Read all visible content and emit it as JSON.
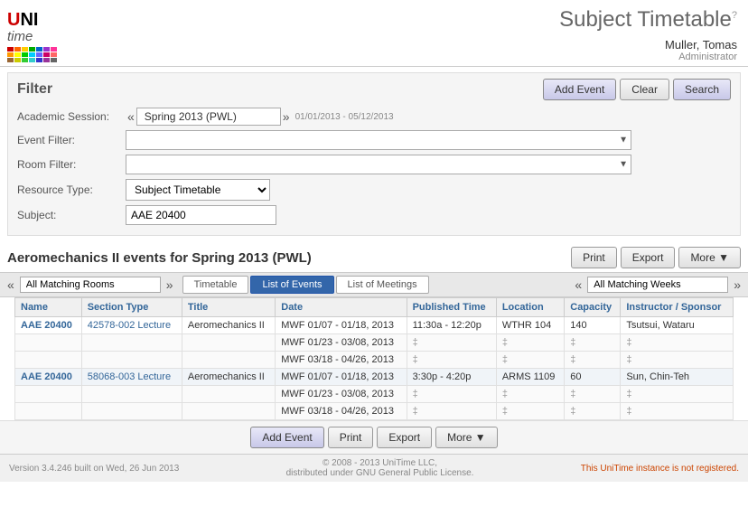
{
  "header": {
    "title": "Subject Timetable",
    "title_sup": "?",
    "logo_text_uni": "UNI",
    "logo_text_time": "time",
    "user_name": "Muller, Tomas",
    "user_role": "Administrator"
  },
  "filter": {
    "title": "Filter",
    "add_event_label": "Add Event",
    "clear_label": "Clear",
    "search_label": "Search",
    "academic_session_label": "Academic Session:",
    "academic_session_value": "Spring 2013 (PWL)",
    "academic_session_dates": "01/01/2013 - 05/12/2013",
    "event_filter_label": "Event Filter:",
    "event_filter_placeholder": "",
    "room_filter_label": "Room Filter:",
    "room_filter_placeholder": "",
    "resource_type_label": "Resource Type:",
    "resource_type_value": "Subject Timetable",
    "subject_label": "Subject:",
    "subject_value": "AAE 20400"
  },
  "results": {
    "title": "Aeromechanics II events for Spring 2013 (PWL)",
    "print_label": "Print",
    "export_label": "Export",
    "more_label": "More ▼",
    "room_filter_value": "All Matching Rooms",
    "week_filter_value": "All Matching Weeks",
    "tabs": [
      {
        "id": "timetable",
        "label": "Timetable",
        "active": false
      },
      {
        "id": "list-events",
        "label": "List of Events",
        "active": true
      },
      {
        "id": "list-meetings",
        "label": "List of Meetings",
        "active": false
      }
    ],
    "table_headers": [
      "Name",
      "Section Type",
      "Title",
      "Date",
      "Published Time",
      "Location",
      "Capacity",
      "Instructor / Sponsor"
    ],
    "rows": [
      {
        "group": true,
        "name": "AAE 20400",
        "section": "42578-002",
        "type": "Lecture",
        "title": "Aeromechanics II",
        "date": "MWF 01/07 - 01/18, 2013",
        "pub_time": "11:30a - 12:20p",
        "location": "WTHR 104",
        "capacity": "140",
        "instructor": "Tsutsui, Wataru"
      },
      {
        "group": false,
        "name": "",
        "section": "",
        "type": "",
        "title": "",
        "date": "MWF 01/23 - 03/08, 2013",
        "pub_time": "‡",
        "location": "‡",
        "capacity": "‡",
        "instructor": "‡"
      },
      {
        "group": false,
        "name": "",
        "section": "",
        "type": "",
        "title": "",
        "date": "MWF 03/18 - 04/26, 2013",
        "pub_time": "‡",
        "location": "‡",
        "capacity": "‡",
        "instructor": "‡"
      },
      {
        "group": true,
        "name": "AAE 20400",
        "section": "58068-003",
        "type": "Lecture",
        "title": "Aeromechanics II",
        "date": "MWF 01/07 - 01/18, 2013",
        "pub_time": "3:30p - 4:20p",
        "location": "ARMS 1109",
        "capacity": "60",
        "instructor": "Sun, Chin-Teh"
      },
      {
        "group": false,
        "name": "",
        "section": "",
        "type": "",
        "title": "",
        "date": "MWF 01/23 - 03/08, 2013",
        "pub_time": "‡",
        "location": "‡",
        "capacity": "‡",
        "instructor": "‡"
      },
      {
        "group": false,
        "name": "",
        "section": "",
        "type": "",
        "title": "",
        "date": "MWF 03/18 - 04/26, 2013",
        "pub_time": "‡",
        "location": "‡",
        "capacity": "‡",
        "instructor": "‡"
      }
    ]
  },
  "footer": {
    "version": "Version 3.4.246 built on Wed, 26 Jun 2013",
    "copyright": "© 2008 - 2013 UniTime LLC,",
    "copyright2": "distributed under GNU General Public License.",
    "notice": "This UniTime instance is not registered."
  },
  "colors": {
    "grid": [
      "#cc0000",
      "#ff6600",
      "#ffcc00",
      "#00aa00",
      "#0066cc",
      "#9933cc",
      "#ff99cc",
      "#66ccff",
      "#99ff99",
      "#ffcc99",
      "#cc9966",
      "#666666",
      "#aaaaaa",
      "#ffffff",
      "#000033",
      "#003300",
      "#330000",
      "#003333",
      "#333300",
      "#330033",
      "#003300",
      "#330033",
      "#003333",
      "#333300",
      "#003300",
      "#003300",
      "#330033"
    ]
  }
}
